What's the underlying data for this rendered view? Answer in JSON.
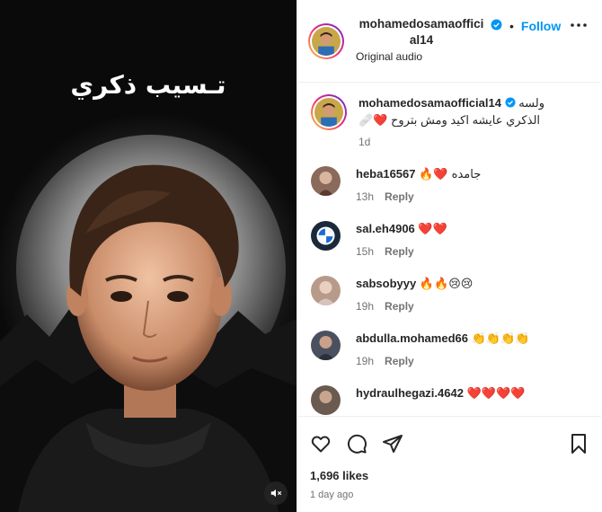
{
  "media": {
    "overlay_title": "تـسيب ذكري",
    "mute_icon": "speaker-muted-icon"
  },
  "header": {
    "username": "mohamedosamaofficial14",
    "dot": "•",
    "follow_label": "Follow",
    "audio": "Original audio",
    "more_icon": "more-horizontal-icon"
  },
  "caption": {
    "username": "mohamedosamaofficial14",
    "text_line1": "ولسه",
    "text_line2": "الذكري عايشه اكيد ومش بتروح ❤️🩹",
    "time": "1d"
  },
  "comments": [
    {
      "username": "heba16567",
      "text": "جامده ❤️🔥",
      "time": "13h",
      "reply": "Reply",
      "avatar_color": "#8a6a5a"
    },
    {
      "username": "sal.eh4906",
      "text": "❤️❤️",
      "time": "15h",
      "reply": "Reply",
      "avatar_color": "#1b2a3a"
    },
    {
      "username": "sabsobyyy",
      "text": "🔥🔥😢😢",
      "time": "19h",
      "reply": "Reply",
      "avatar_color": "#b89a8a"
    },
    {
      "username": "abdulla.mohamed66",
      "text": "👏👏👏👏",
      "time": "19h",
      "reply": "Reply",
      "avatar_color": "#4a5060"
    },
    {
      "username": "hydraulhegazi.4642",
      "text": "❤️❤️❤️❤️",
      "time": "",
      "reply": "",
      "avatar_color": "#6a5a50"
    }
  ],
  "footer": {
    "likes": "1,696 likes",
    "ago": "1 day ago"
  },
  "colors": {
    "accent": "#0095f6",
    "text": "#262626",
    "muted": "#737373",
    "like_heart": "#ed4956"
  }
}
